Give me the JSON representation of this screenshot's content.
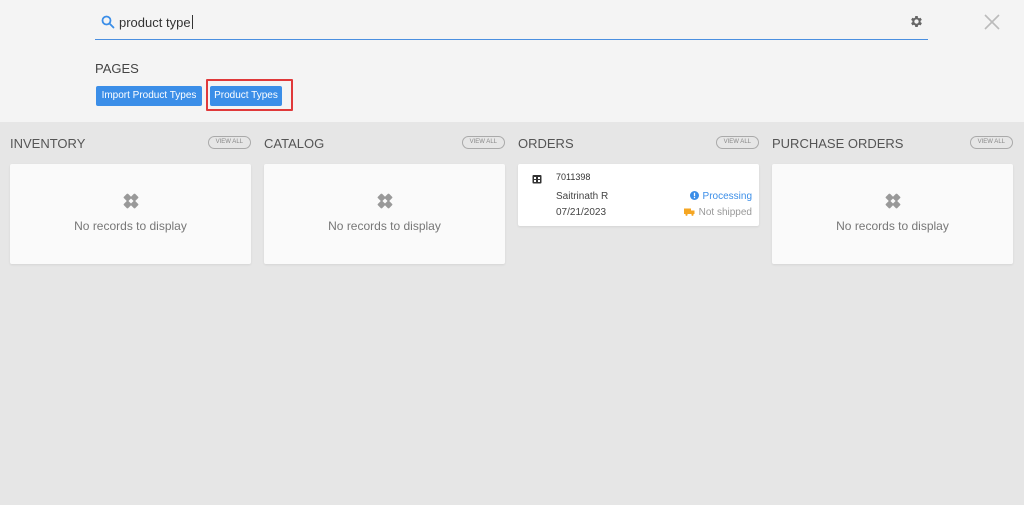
{
  "search": {
    "query": "product type"
  },
  "pages": {
    "title": "PAGES",
    "buttons": [
      {
        "label": "Import Product Types"
      },
      {
        "label": "Product Types"
      }
    ]
  },
  "columns": [
    {
      "title": "INVENTORY",
      "view_all": "VIEW ALL",
      "empty_text": "No records to display"
    },
    {
      "title": "CATALOG",
      "view_all": "VIEW ALL",
      "empty_text": "No records to display"
    },
    {
      "title": "ORDERS",
      "view_all": "VIEW ALL",
      "order": {
        "number": "7011398",
        "customer": "Saitrinath R",
        "date": "07/21/2023",
        "status": "Processing",
        "shipping": "Not shipped"
      }
    },
    {
      "title": "PURCHASE ORDERS",
      "view_all": "VIEW ALL",
      "empty_text": "No records to display"
    }
  ],
  "colors": {
    "accent": "#3b8ee8",
    "highlight": "#e0393a",
    "shipping_icon": "#f5a623"
  }
}
